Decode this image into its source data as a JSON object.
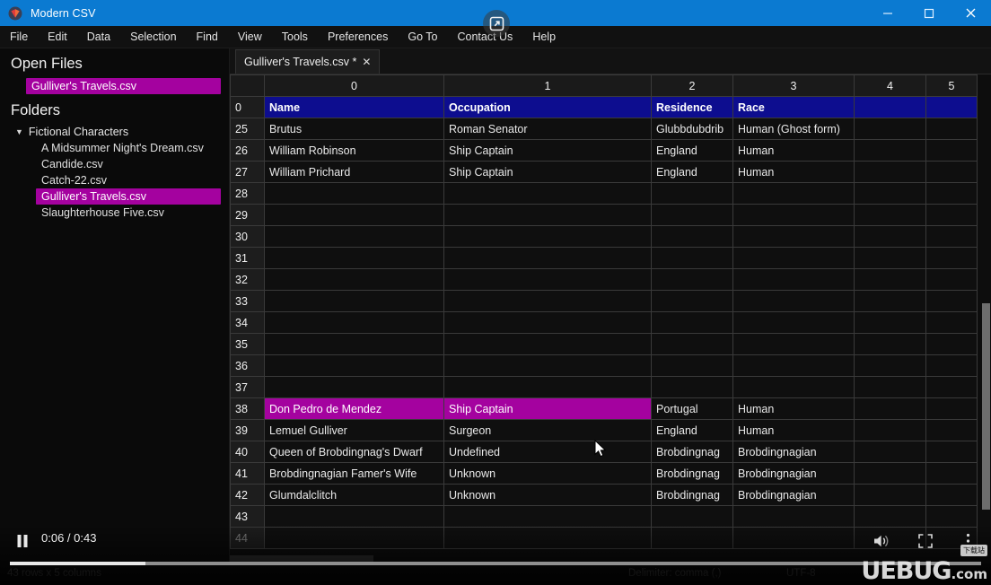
{
  "window": {
    "title": "Modern CSV",
    "logo_icon": "modern-csv-logo-icon",
    "minimize_label": "–",
    "maximize_label": "□",
    "close_label": "✕"
  },
  "menubar": {
    "items": [
      "File",
      "Edit",
      "Data",
      "Selection",
      "Find",
      "View",
      "Tools",
      "Preferences",
      "Go To",
      "Contact Us",
      "Help"
    ]
  },
  "overlay": {
    "pip_icon": "picture-in-picture-icon"
  },
  "sidebar": {
    "open_files_heading": "Open Files",
    "open_files": [
      "Gulliver's Travels.csv"
    ],
    "folders_heading": "Folders",
    "folder": {
      "name": "Fictional Characters",
      "expander": "▼",
      "files": [
        "A Midsummer Night's Dream.csv",
        "Candide.csv",
        "Catch-22.csv",
        "Gulliver's Travels.csv",
        "Slaughterhouse Five.csv"
      ],
      "selected_file": "Gulliver's Travels.csv"
    }
  },
  "tabs": [
    {
      "label": "Gulliver's Travels.csv *",
      "close_glyph": "✕",
      "active": true
    }
  ],
  "grid": {
    "column_headers": [
      "0",
      "1",
      "2",
      "3",
      "4",
      "5"
    ],
    "rows": [
      {
        "num": "0",
        "style": "header",
        "cells": [
          "Name",
          "Occupation",
          "Residence",
          "Race",
          "",
          ""
        ]
      },
      {
        "num": "25",
        "style": "data",
        "cells": [
          "Brutus",
          "Roman Senator",
          "Glubbdubdrib",
          "Human (Ghost form)",
          "",
          ""
        ]
      },
      {
        "num": "26",
        "style": "data",
        "cells": [
          "William Robinson",
          "Ship Captain",
          "England",
          "Human",
          "",
          ""
        ]
      },
      {
        "num": "27",
        "style": "data",
        "cells": [
          "William Prichard",
          "Ship Captain",
          "England",
          "Human",
          "",
          ""
        ]
      },
      {
        "num": "28",
        "style": "data",
        "cells": [
          "",
          "",
          "",
          "",
          "",
          ""
        ]
      },
      {
        "num": "29",
        "style": "data",
        "cells": [
          "",
          "",
          "",
          "",
          "",
          ""
        ]
      },
      {
        "num": "30",
        "style": "data",
        "cells": [
          "",
          "",
          "",
          "",
          "",
          ""
        ]
      },
      {
        "num": "31",
        "style": "data",
        "cells": [
          "",
          "",
          "",
          "",
          "",
          ""
        ]
      },
      {
        "num": "32",
        "style": "data",
        "cells": [
          "",
          "",
          "",
          "",
          "",
          ""
        ]
      },
      {
        "num": "33",
        "style": "data",
        "cells": [
          "",
          "",
          "",
          "",
          "",
          ""
        ]
      },
      {
        "num": "34",
        "style": "data",
        "cells": [
          "",
          "",
          "",
          "",
          "",
          ""
        ]
      },
      {
        "num": "35",
        "style": "data",
        "cells": [
          "",
          "",
          "",
          "",
          "",
          ""
        ]
      },
      {
        "num": "36",
        "style": "data",
        "cells": [
          "",
          "",
          "",
          "",
          "",
          ""
        ]
      },
      {
        "num": "37",
        "style": "data",
        "cells": [
          "",
          "",
          "",
          "",
          "",
          ""
        ]
      },
      {
        "num": "38",
        "style": "selected",
        "selected_cells": [
          0,
          1
        ],
        "cells": [
          "Don Pedro de Mendez",
          "Ship Captain",
          "Portugal",
          "Human",
          "",
          ""
        ]
      },
      {
        "num": "39",
        "style": "data",
        "cells": [
          "Lemuel Gulliver",
          "Surgeon",
          "England",
          "Human",
          "",
          ""
        ]
      },
      {
        "num": "40",
        "style": "data",
        "cells": [
          "Queen of Brobdingnag's Dwarf",
          "Undefined",
          "Brobdingnag",
          "Brobdingnagian",
          "",
          ""
        ]
      },
      {
        "num": "41",
        "style": "data",
        "cells": [
          "Brobdingnagian Famer's Wife",
          "Unknown",
          "Brobdingnag",
          "Brobdingnagian",
          "",
          ""
        ]
      },
      {
        "num": "42",
        "style": "data",
        "cells": [
          "Glumdalclitch",
          "Unknown",
          "Brobdingnag",
          "Brobdingnagian",
          "",
          ""
        ]
      },
      {
        "num": "43",
        "style": "data",
        "cells": [
          "",
          "",
          "",
          "",
          "",
          ""
        ]
      },
      {
        "num": "44",
        "style": "faded",
        "cells": [
          "",
          "",
          "",
          "",
          "",
          ""
        ]
      }
    ]
  },
  "statusbar": {
    "dimensions": "43 rows x 5 columns",
    "delimiter": "Delimiter: comma (,)",
    "encoding": "UTF-8"
  },
  "player": {
    "state_icon": "pause-icon",
    "time": "0:06 / 0:43",
    "progress_percent": 14,
    "volume_icon": "volume-icon",
    "fullscreen_icon": "fullscreen-icon",
    "more_icon": "more-options-icon"
  },
  "watermark": {
    "brand": "UEBUG",
    "suffix": ".com",
    "badge": "下载站"
  },
  "colors": {
    "titlebar": "#0b7ad1",
    "selection_magenta": "#a4029f",
    "header_row_blue": "#0d0d8f",
    "grid_line": "#3a3a3a"
  }
}
